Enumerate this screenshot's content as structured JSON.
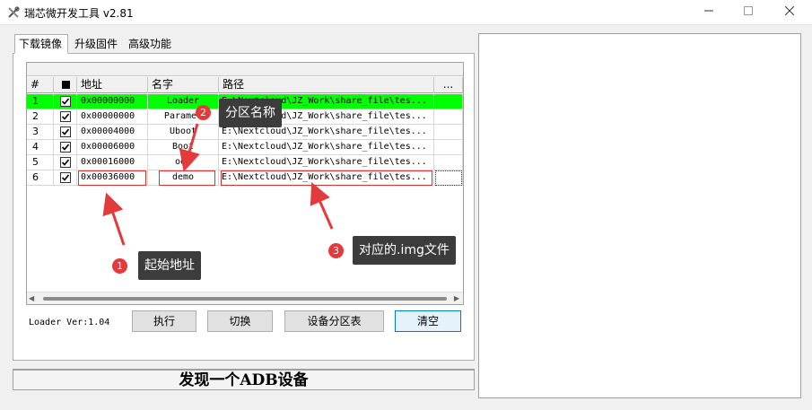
{
  "window": {
    "title": "瑞芯微开发工具 v2.81",
    "minimize_icon": "minimize-icon",
    "maximize_icon": "maximize-icon",
    "close_icon": "close-icon"
  },
  "tabs": [
    {
      "label": "下载镜像",
      "active": true
    },
    {
      "label": "升级固件",
      "active": false
    },
    {
      "label": "高级功能",
      "active": false
    }
  ],
  "grid": {
    "headers": {
      "index": "#",
      "check": "■",
      "address": "地址",
      "name": "名字",
      "path": "路径",
      "more": "..."
    },
    "rows": [
      {
        "index": "1",
        "checked": true,
        "address": "0x00000000",
        "name": "Loader",
        "path": "E:\\Nextcloud\\JZ_Work\\share_file\\tes...",
        "highlight": true
      },
      {
        "index": "2",
        "checked": true,
        "address": "0x00000000",
        "name": "Paramet",
        "path": "E:\\Nextcloud\\JZ_Work\\share_file\\tes..."
      },
      {
        "index": "3",
        "checked": true,
        "address": "0x00004000",
        "name": "Uboot",
        "path": "E:\\Nextcloud\\JZ_Work\\share_file\\tes..."
      },
      {
        "index": "4",
        "checked": true,
        "address": "0x00006000",
        "name": "Boot",
        "path": "E:\\Nextcloud\\JZ_Work\\share_file\\tes..."
      },
      {
        "index": "5",
        "checked": true,
        "address": "0x00016000",
        "name": "oem",
        "path": "E:\\Nextcloud\\JZ_Work\\share_file\\tes..."
      },
      {
        "index": "6",
        "checked": true,
        "address": "0x00036000",
        "name": "demo",
        "path": "E:\\Nextcloud\\JZ_Work\\share_file\\tes..."
      }
    ]
  },
  "footer": {
    "loader_version": "Loader Ver:1.04",
    "execute_label": "执行",
    "switch_label": "切换",
    "partition_table_label": "设备分区表",
    "clear_label": "清空"
  },
  "status": {
    "text": "发现一个ADB设备"
  },
  "annotations": {
    "colors": {
      "callout_bg": "#3c3c3c",
      "badge": "#e33b3b",
      "highlight_row": "#00ff00"
    },
    "items": [
      {
        "number": "1",
        "text": "起始地址"
      },
      {
        "number": "2",
        "text": "分区名称"
      },
      {
        "number": "3",
        "text": "对应的.img文件"
      }
    ]
  }
}
